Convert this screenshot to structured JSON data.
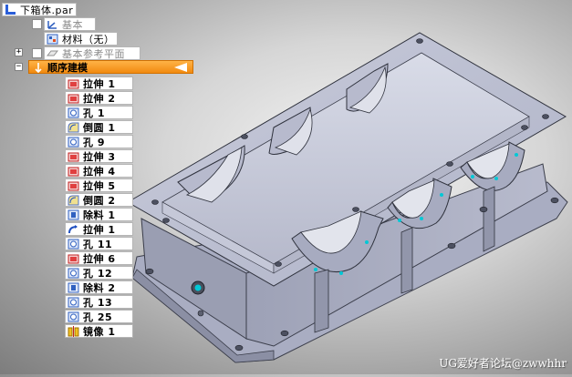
{
  "tree": {
    "root": "下箱体.par",
    "base": "基本",
    "material": "材料（无）",
    "ref_planes": "基本参考平面",
    "sequence": "顺序建模",
    "features": [
      {
        "icon": "extrude",
        "label": "拉伸 1"
      },
      {
        "icon": "extrude",
        "label": "拉伸 2"
      },
      {
        "icon": "hole",
        "label": "孔 1"
      },
      {
        "icon": "round",
        "label": "倒圆 1"
      },
      {
        "icon": "hole",
        "label": "孔 9"
      },
      {
        "icon": "extrude",
        "label": "拉伸 3"
      },
      {
        "icon": "extrude",
        "label": "拉伸 4"
      },
      {
        "icon": "extrude",
        "label": "拉伸 5"
      },
      {
        "icon": "round",
        "label": "倒圆 2"
      },
      {
        "icon": "cut",
        "label": "除料 1"
      },
      {
        "icon": "extrude-blue",
        "label": "拉伸 1"
      },
      {
        "icon": "hole",
        "label": "孔 11"
      },
      {
        "icon": "extrude",
        "label": "拉伸 6"
      },
      {
        "icon": "hole",
        "label": "孔 12"
      },
      {
        "icon": "cut",
        "label": "除料 2"
      },
      {
        "icon": "hole",
        "label": "孔 13"
      },
      {
        "icon": "hole",
        "label": "孔 25"
      },
      {
        "icon": "mirror",
        "label": "镜像 1"
      }
    ]
  },
  "watermark": "UG爱好者论坛@zwwhhr",
  "colors": {
    "selection": "#f28a10",
    "model": "#aeb2c8",
    "model_dark": "#7c8096",
    "hole_accent": "#00c8d6"
  }
}
